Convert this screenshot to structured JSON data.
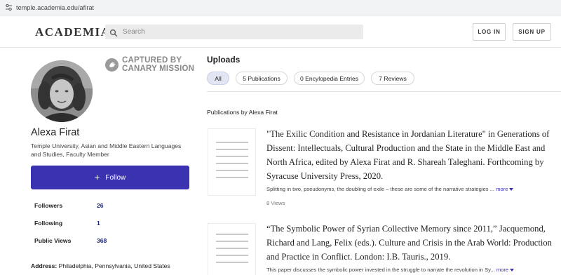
{
  "browser": {
    "url": "temple.academia.edu/afirat",
    "site_info_icon": "tune-icon"
  },
  "header": {
    "logo": "ACADEMIA",
    "search_placeholder": "Search",
    "search_icon": "search-icon",
    "login_label": "LOG IN",
    "signup_label": "SIGN UP"
  },
  "profile": {
    "name": "Alexa Firat",
    "affiliation": "Temple University, Asian and Middle Eastern Languages and Studies, Faculty Member",
    "follow_plus": "+",
    "follow_label": "Follow",
    "canary": {
      "line1": "CAPTURED BY",
      "line2": "CANARY MISSION"
    },
    "stats": [
      {
        "label": "Followers",
        "value": "26"
      },
      {
        "label": "Following",
        "value": "1"
      },
      {
        "label": "Public Views",
        "value": "368"
      }
    ],
    "address_label": "Address:",
    "address_value": "Philadelphia, Pennsylvania, United States"
  },
  "uploads": {
    "title": "Uploads",
    "tabs": [
      {
        "label": "All",
        "active": true
      },
      {
        "label": "5 Publications",
        "active": false
      },
      {
        "label": "0 Encylopedia Entries",
        "active": false
      },
      {
        "label": "7 Reviews",
        "active": false
      }
    ],
    "publications_heading": "Publications by Alexa Firat",
    "more_label": "more",
    "items": [
      {
        "title": "\"The Exilic Condition and Resistance in Jordanian Literature\" in Generations of Dissent: Intellectuals, Cultural Production and the State in the Middle East and North Africa, edited by Alexa Firat and R. Shareah Taleghani. Forthcoming by Syracuse University Press, 2020.",
        "snippet": "Splitting in two, pseudonyms, the doubling of exile – these are some of the narrative strategies ...",
        "views": "8 Views"
      },
      {
        "title": "“The Symbolic Power of Syrian Collective Memory since 2011,” Jacquemond, Richard and Lang, Felix (eds.). Culture and Crisis in the Arab World: Production and Practice in Conflict. London: I.B. Tauris., 2019.",
        "snippet": "This paper discusses the symbolic power invested in the struggle to narrate the revolution in Sy...",
        "views": ""
      }
    ]
  },
  "colors": {
    "accent": "#3a32b1",
    "stat_value": "#1f2a7a",
    "active_tab_bg": "#e2e6f3"
  }
}
